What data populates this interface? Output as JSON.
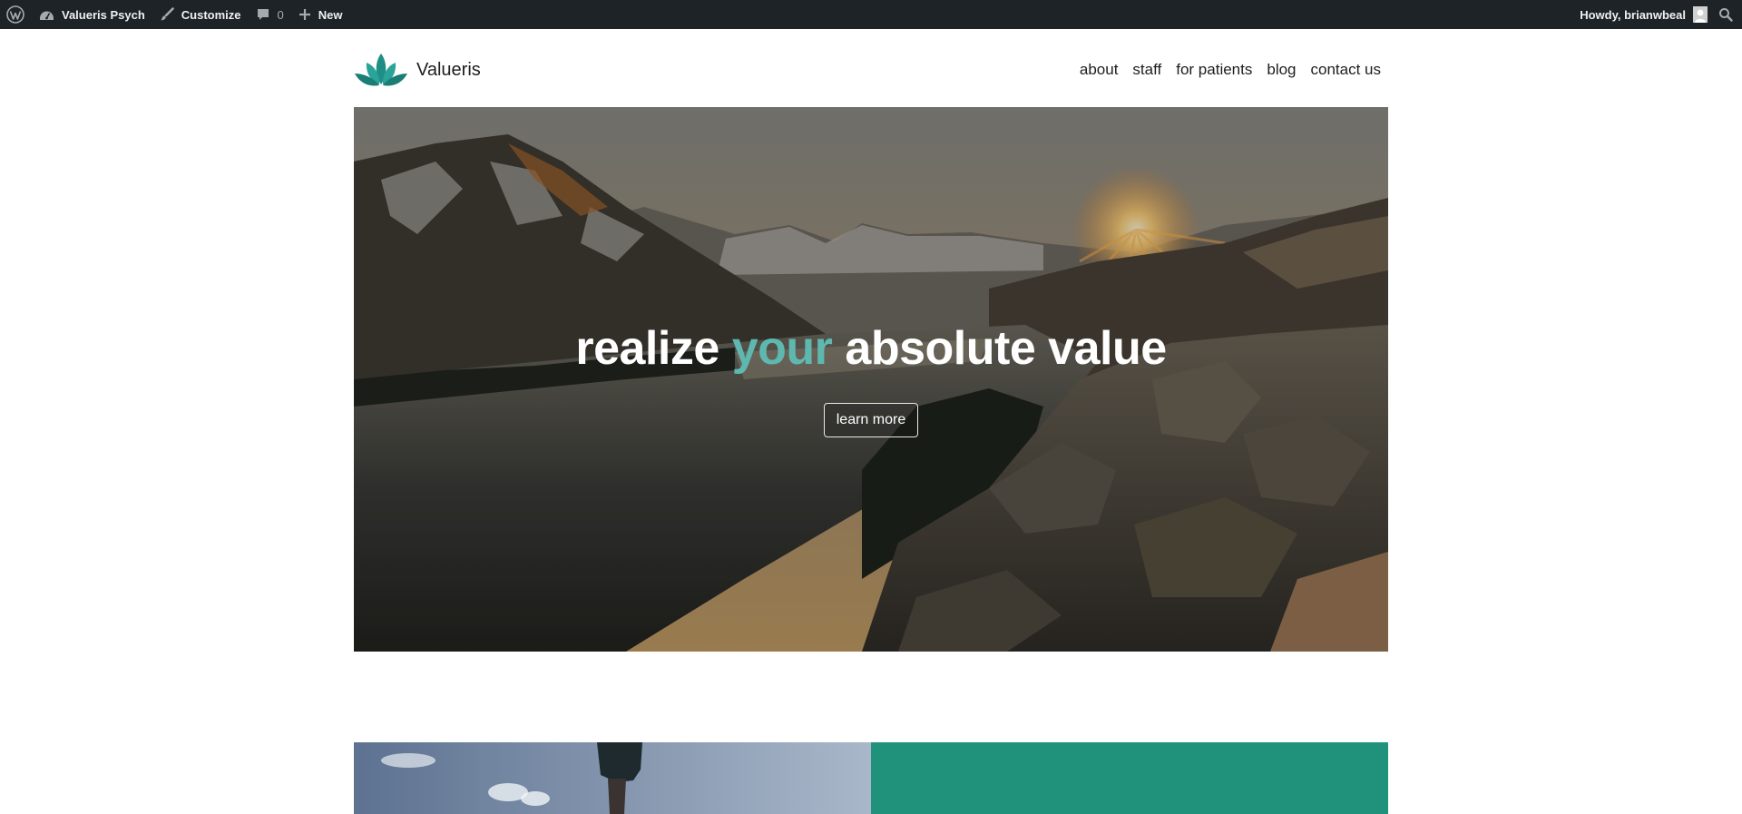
{
  "admin_bar": {
    "site_name": "Valueris Psych",
    "customize_label": "Customize",
    "comments_count": "0",
    "new_label": "New",
    "greeting": "Howdy, brianwbeal"
  },
  "header": {
    "brand_name": "Valueris",
    "nav": [
      {
        "label": "about"
      },
      {
        "label": "staff"
      },
      {
        "label": "for patients"
      },
      {
        "label": "blog"
      },
      {
        "label": "contact us"
      }
    ]
  },
  "hero": {
    "title_part1": "realize",
    "title_accent": "your",
    "title_part2": "absolute value",
    "button_label": "learn more"
  },
  "colors": {
    "admin_bar_bg": "#1d2327",
    "accent_teal": "#5fb8b0",
    "section_green": "#20917a",
    "logo_teal": "#1f8f86"
  }
}
